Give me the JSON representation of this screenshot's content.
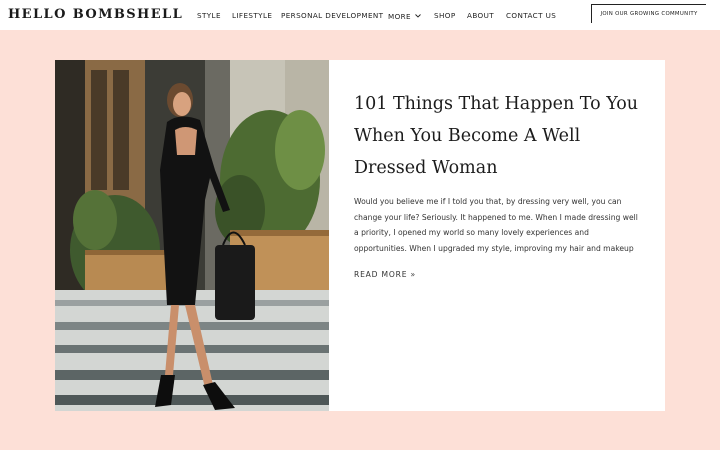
{
  "site": {
    "logo": "HELLO BOMBSHELL"
  },
  "nav": {
    "items": [
      {
        "label": "STYLE"
      },
      {
        "label": "LIFESTYLE"
      },
      {
        "label": "PERSONAL DEVELOPMENT"
      },
      {
        "label": "MORE",
        "has_dropdown": true
      },
      {
        "label": "SHOP"
      },
      {
        "label": "ABOUT"
      },
      {
        "label": "CONTACT US"
      }
    ],
    "cta_label": "JOIN OUR GROWING COMMUNITY"
  },
  "post": {
    "title": "101 Things That Happen To You When You Become A Well Dressed Woman",
    "excerpt": "Would you believe me if I told you that, by dressing very well, you can change your life?   Seriously. It happened to me. When I made dressing well a priority, I opened my world so many lovely experiences and opportunities. When I upgraded my style, improving my hair and makeup",
    "read_more": "READ MORE »"
  },
  "icons": {
    "dropdown": "chevron-down-icon"
  },
  "colors": {
    "background": "#fde0d7",
    "card": "#ffffff",
    "text": "#1c1c1c"
  }
}
